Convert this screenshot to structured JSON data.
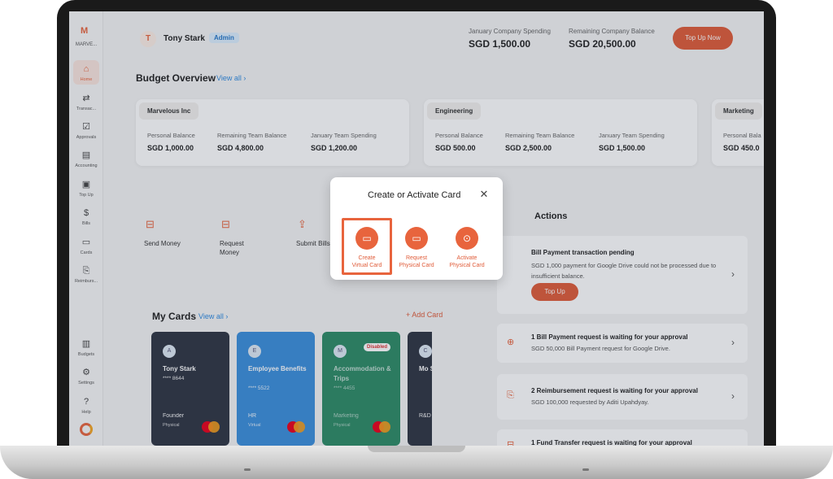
{
  "sidebar": {
    "brand_letter": "M",
    "brand_name": "MARVE...",
    "items": [
      {
        "label": "Home",
        "icon": "home-icon"
      },
      {
        "label": "Transac...",
        "icon": "transfer-icon"
      },
      {
        "label": "Approvals",
        "icon": "approvals-icon"
      },
      {
        "label": "Accounting",
        "icon": "accounting-icon"
      },
      {
        "label": "Top Up",
        "icon": "topup-icon"
      },
      {
        "label": "Bills",
        "icon": "bills-icon"
      },
      {
        "label": "Cards",
        "icon": "cards-icon"
      },
      {
        "label": "Reimburs...",
        "icon": "reimburse-icon"
      },
      {
        "label": "Budgets",
        "icon": "budgets-icon"
      },
      {
        "label": "Settings",
        "icon": "settings-icon"
      },
      {
        "label": "Help",
        "icon": "help-icon"
      }
    ]
  },
  "header": {
    "avatar_letter": "T",
    "user_name": "Tony Stark",
    "role": "Admin",
    "spending_label": "January Company Spending",
    "spending_value": "SGD 1,500.00",
    "balance_label": "Remaining Company Balance",
    "balance_value": "SGD 20,500.00",
    "topup_button": "Top Up Now"
  },
  "budget": {
    "title": "Budget Overview",
    "view_all": "View all",
    "cards": [
      {
        "name": "Marvelous Inc",
        "k1": "Personal Balance",
        "v1": "SGD 1,000.00",
        "k2": "Remaining Team Balance",
        "v2": "SGD 4,800.00",
        "k3": "January Team Spending",
        "v3": "SGD 1,200.00"
      },
      {
        "name": "Engineering",
        "k1": "Personal Balance",
        "v1": "SGD 500.00",
        "k2": "Remaining Team Balance",
        "v2": "SGD 2,500.00",
        "k3": "January Team Spending",
        "v3": "SGD 1,500.00"
      },
      {
        "name": "Marketing",
        "k1": "Personal Bala",
        "v1": "SGD 450.0"
      }
    ]
  },
  "actions": {
    "send": "Send Money",
    "request": "Request Money",
    "submit": "Submit Bills"
  },
  "transactions": {
    "title": "Actions",
    "items": [
      {
        "title": "Bill Payment transaction pending",
        "desc": "SGD 1,000 payment for Google Drive could not be processed due to insufficient balance."
      },
      {
        "title": "1 Bill Payment request is waiting for your approval",
        "desc": "SGD 50,000 Bill Payment request for Google Drive."
      },
      {
        "title": "2 Reimbursement request is waiting for your approval",
        "desc": "SGD 100,000 requested by Aditi Upahdyay."
      },
      {
        "title": "1 Fund Transfer request is waiting for your approval",
        "desc": ""
      }
    ],
    "topup_button": "Top Up"
  },
  "cards": {
    "title": "My Cards",
    "view_all": "View all",
    "add_card": "+ Add Card",
    "items": [
      {
        "avatar": "A",
        "name": "Tony Stark",
        "number": "**** 8644",
        "role": "Founder",
        "type": "Physical",
        "color": "#2f3542"
      },
      {
        "avatar": "E",
        "name": "Employee Benefits",
        "number": "**** 5522",
        "role": "HR",
        "type": "Virtual",
        "color": "#3b8fdc"
      },
      {
        "avatar": "M",
        "name": "Accommodation & Trips",
        "number": "**** 4455",
        "role": "Marketing",
        "type": "Physical",
        "color": "#2e8b66",
        "badge": "Disabled"
      },
      {
        "avatar": "C",
        "name": "Mo Sub",
        "number": "",
        "role": "R&D",
        "type": "",
        "color": "#2f3542"
      }
    ]
  },
  "modal": {
    "title": "Create or Activate Card",
    "options": [
      {
        "label_1": "Create",
        "label_2": "Virtual Card",
        "icon": "virtual-card-icon"
      },
      {
        "label_1": "Request",
        "label_2": "Physical Card",
        "icon": "physical-card-icon"
      },
      {
        "label_1": "Activate",
        "label_2": "Physical Card",
        "icon": "activate-card-icon"
      }
    ]
  },
  "colors": {
    "accent": "#e05c39",
    "link": "#2f8ae0"
  }
}
